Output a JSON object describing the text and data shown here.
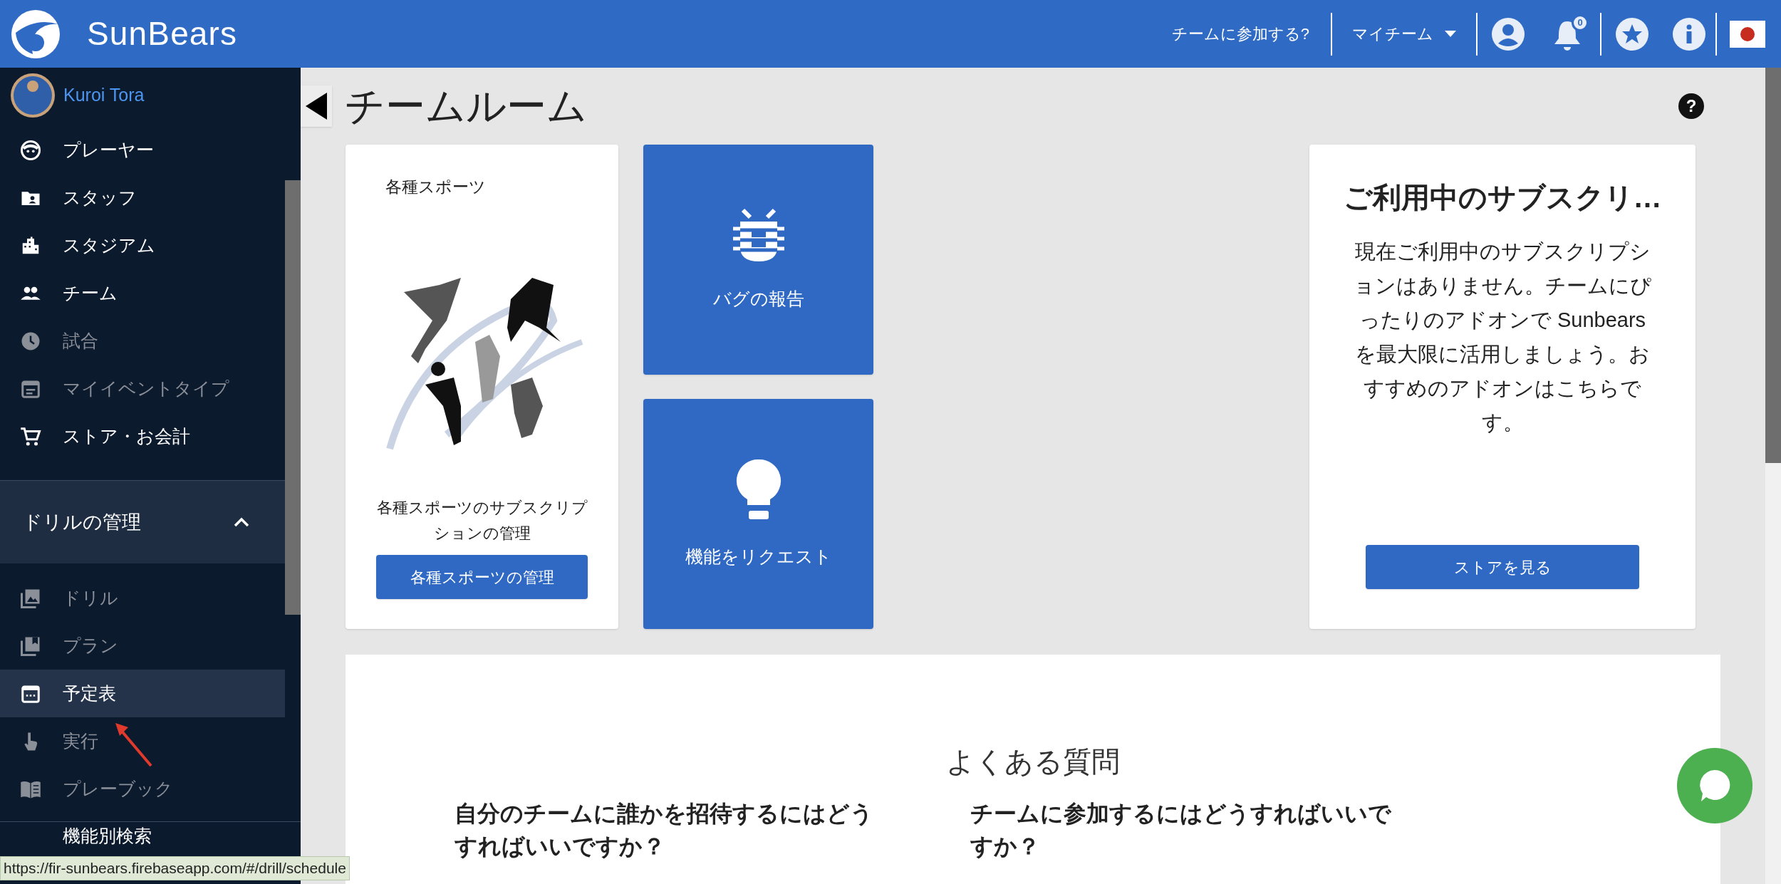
{
  "header": {
    "logo_text": "SunBears",
    "join_link": "チームに参加する?",
    "team_menu": "マイチーム",
    "notification_count": "0"
  },
  "sidebar": {
    "user": {
      "name": "Kuroi Tora"
    },
    "items": [
      {
        "label": "プレーヤー",
        "dimmed": false,
        "selected": false
      },
      {
        "label": "スタッフ",
        "dimmed": false,
        "selected": false
      },
      {
        "label": "スタジアム",
        "dimmed": false,
        "selected": false
      },
      {
        "label": "チーム",
        "dimmed": false,
        "selected": false
      },
      {
        "label": "試合",
        "dimmed": true,
        "selected": false
      },
      {
        "label": "マイイベントタイプ",
        "dimmed": true,
        "selected": false
      },
      {
        "label": "ストア・お会計",
        "dimmed": false,
        "selected": false
      }
    ],
    "section": {
      "title": "ドリルの管理",
      "expanded": true,
      "items": [
        {
          "label": "ドリル",
          "dimmed": true,
          "selected": false
        },
        {
          "label": "プラン",
          "dimmed": true,
          "selected": false
        },
        {
          "label": "予定表",
          "dimmed": false,
          "selected": true
        },
        {
          "label": "実行",
          "dimmed": true,
          "selected": false
        },
        {
          "label": "プレーブック",
          "dimmed": true,
          "selected": false
        }
      ]
    },
    "cut_item": "機能別検索"
  },
  "main": {
    "title": "チームルーム",
    "help_icon": "?",
    "sports_card": {
      "heading": "各種スポーツ",
      "description": "各種スポーツのサブスクリプションの管理",
      "button": "各種スポーツの管理"
    },
    "tiles": [
      {
        "label": "バグの報告"
      },
      {
        "label": "機能をリクエスト"
      }
    ],
    "subscription_card": {
      "title": "ご利用中のサブスクリ…",
      "body": "現在ご利用中のサブスクリプションはありません。チームにぴったりのアドオンで Sunbears を最大限に活用しましょう。おすすめのアドオンはこちらです。",
      "button": "ストアを見る"
    },
    "faq": {
      "title": "よくある質問",
      "questions": [
        "自分のチームに誰かを招待するにはどうすればいいですか？",
        "チームに参加するにはどうすればいいですか？"
      ]
    }
  },
  "status_url": "https://fir-sunbears.firebaseapp.com/#/drill/schedule"
}
